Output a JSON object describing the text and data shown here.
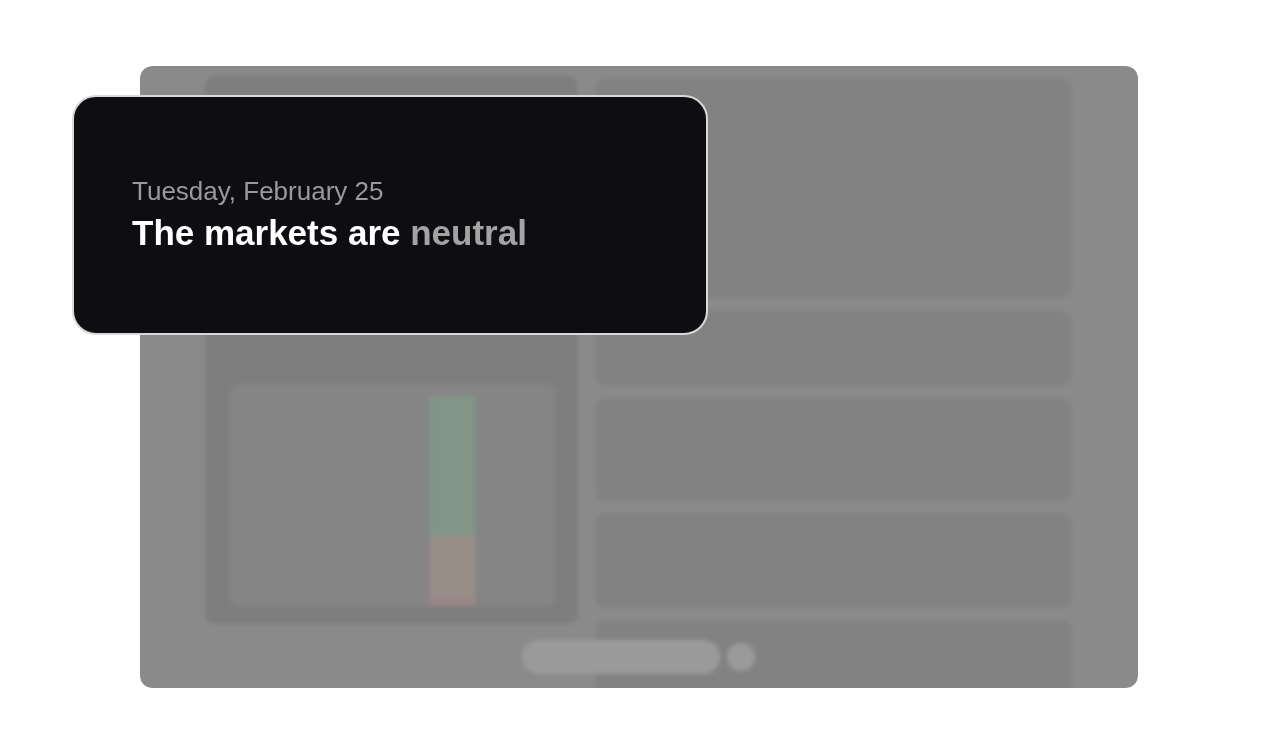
{
  "callout": {
    "date": "Tuesday, February 25",
    "headline": "The markets are",
    "sentiment": "neutral"
  }
}
